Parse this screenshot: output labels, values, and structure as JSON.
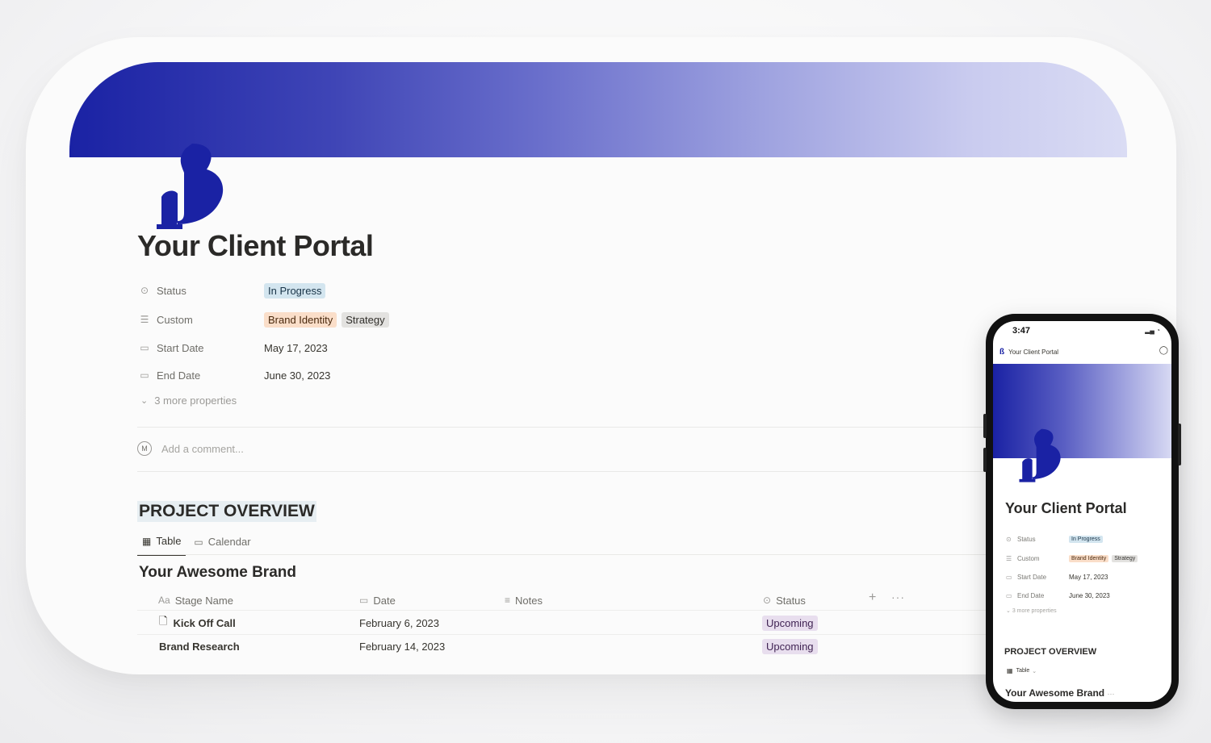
{
  "page": {
    "title": "Your Client Portal",
    "colors": {
      "cover_start": "#1a22a4",
      "cover_end": "#dadcf4",
      "brand": "#1a22a4"
    }
  },
  "properties": [
    {
      "icon": "status-icon",
      "label": "Status",
      "tags": [
        {
          "text": "In Progress",
          "color": "blue"
        }
      ]
    },
    {
      "icon": "list-icon",
      "label": "Custom",
      "tags": [
        {
          "text": "Brand Identity",
          "color": "orange"
        },
        {
          "text": "Strategy",
          "color": "gray"
        }
      ]
    },
    {
      "icon": "calendar-icon",
      "label": "Start Date",
      "value": "May 17, 2023"
    },
    {
      "icon": "calendar-icon",
      "label": "End Date",
      "value": "June 30, 2023"
    }
  ],
  "more_properties": "3 more properties",
  "comment": {
    "avatar": "M",
    "placeholder": "Add a comment..."
  },
  "section": {
    "heading": "PROJECT OVERVIEW"
  },
  "tabs": [
    {
      "icon": "table-icon",
      "label": "Table",
      "active": true
    },
    {
      "icon": "calendar-icon",
      "label": "Calendar",
      "active": false
    }
  ],
  "database": {
    "title": "Your Awesome Brand",
    "columns": [
      {
        "icon": "Aa",
        "label": "Stage Name"
      },
      {
        "icon": "calendar-icon",
        "label": "Date"
      },
      {
        "icon": "lines-icon",
        "label": "Notes"
      },
      {
        "icon": "status-icon",
        "label": "Status"
      }
    ],
    "rows": [
      {
        "name": "Kick Off Call",
        "has_doc_icon": true,
        "date": "February 6, 2023",
        "notes": "",
        "status": "Upcoming"
      },
      {
        "name": "Brand Research",
        "has_doc_icon": false,
        "date": "February 14, 2023",
        "notes": "",
        "status": "Upcoming"
      }
    ]
  },
  "phone": {
    "time": "3:47",
    "nav_title": "Your Client Portal",
    "title": "Your Client Portal",
    "properties": [
      {
        "label": "Status",
        "tags": [
          "In Progress"
        ]
      },
      {
        "label": "Custom",
        "tags": [
          "Brand Identity",
          "Strategy"
        ]
      },
      {
        "label": "Start Date",
        "value": "May 17, 2023"
      },
      {
        "label": "End Date",
        "value": "June 30, 2023"
      }
    ],
    "more_properties": "3 more properties",
    "section_heading": "PROJECT OVERVIEW",
    "tab_label": "Table",
    "db_title": "Your Awesome Brand"
  }
}
